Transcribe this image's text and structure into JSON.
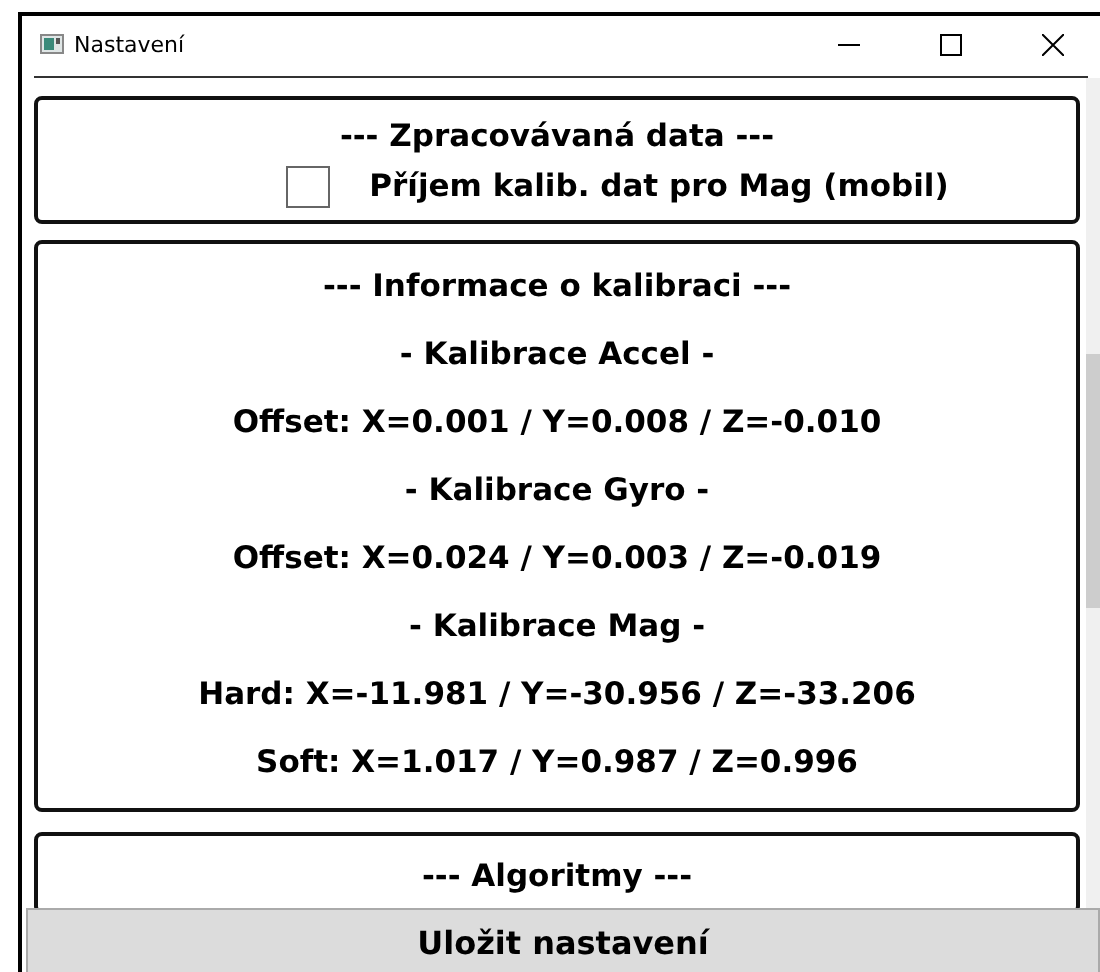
{
  "window": {
    "title": "Nastavení"
  },
  "processed_data": {
    "heading": "--- Zpracovávaná data ---",
    "checkbox": {
      "label": "Příjem kalib. dat pro Mag (mobil)",
      "checked": false
    }
  },
  "calibration_info": {
    "lines": [
      "--- Informace o kalibraci ---",
      "- Kalibrace Accel -",
      "Offset: X=0.001 / Y=0.008 / Z=-0.010",
      "- Kalibrace Gyro -",
      "Offset: X=0.024 / Y=0.003 / Z=-0.019",
      "- Kalibrace Mag -",
      "Hard: X=-11.981 / Y=-30.956 / Z=-33.206",
      "Soft: X=1.017 / Y=0.987 / Z=0.996"
    ]
  },
  "algorithms": {
    "heading": "--- Algoritmy ---"
  },
  "save_button": "Uložit nastavení"
}
